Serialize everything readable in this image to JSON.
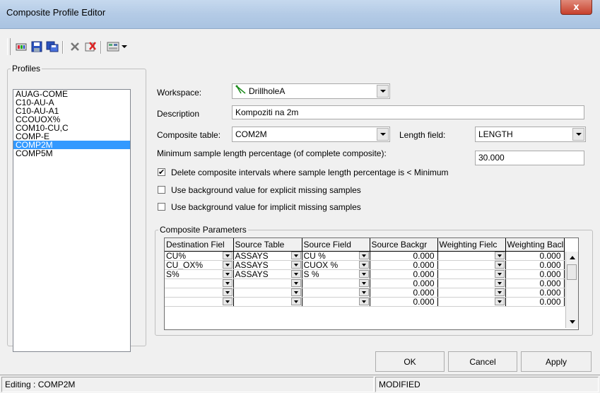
{
  "window": {
    "title": "Composite Profile Editor",
    "close_label": "x"
  },
  "toolbar": {
    "icons": [
      "open-icon",
      "save-icon",
      "save-as-icon",
      "delete-icon",
      "delete-profile-icon",
      "view-options-icon"
    ]
  },
  "profiles": {
    "legend": "Profiles",
    "items": [
      "AUAG-COME",
      "C10-AU-A",
      "C10-AU-A1",
      "CCOUOX%",
      "COM10-CU,C",
      "COMP-E",
      "COMP2M",
      "COMP5M"
    ],
    "selected": "COMP2M"
  },
  "form": {
    "workspace_label": "Workspace:",
    "workspace_value": "DrillholeA",
    "description_label": "Description",
    "description_value": "Kompoziti na 2m",
    "composite_table_label": "Composite table:",
    "composite_table_value": "COM2M",
    "length_field_label": "Length field:",
    "length_field_value": "LENGTH",
    "min_pct_label": "Minimum sample length percentage (of complete composite):",
    "min_pct_value": "30.000",
    "chk_delete_label": "Delete composite intervals where sample length percentage is < Minimum",
    "chk_delete_checked": true,
    "chk_explicit_label": "Use background value for explicit missing samples",
    "chk_explicit_checked": false,
    "chk_implicit_label": "Use background value for implicit missing samples",
    "chk_implicit_checked": false
  },
  "params": {
    "legend": "Composite Parameters",
    "columns": [
      "Destination Fiel",
      "Source Table",
      "Source Field",
      "Source Backgr",
      "Weighting Fielc",
      "Weighting Bacl"
    ],
    "rows": [
      [
        "CU%",
        "ASSAYS",
        "CU %",
        "0.000",
        "",
        "0.000"
      ],
      [
        "CU_OX%",
        "ASSAYS",
        "CUOX %",
        "0.000",
        "",
        "0.000"
      ],
      [
        "S%",
        "ASSAYS",
        "S %",
        "0.000",
        "",
        "0.000"
      ],
      [
        "",
        "",
        "",
        "0.000",
        "",
        "0.000"
      ],
      [
        "",
        "",
        "",
        "0.000",
        "",
        "0.000"
      ],
      [
        "",
        "",
        "",
        "0.000",
        "",
        "0.000"
      ]
    ]
  },
  "buttons": {
    "ok": "OK",
    "cancel": "Cancel",
    "apply": "Apply"
  },
  "status": {
    "left": "Editing : COMP2M",
    "right": "MODIFIED"
  }
}
